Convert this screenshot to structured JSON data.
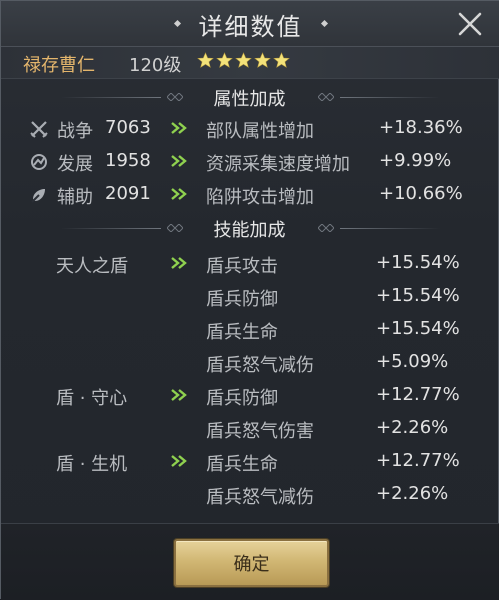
{
  "title": "详细数值",
  "hero": {
    "name": "禄存曹仁",
    "level": "120级",
    "stars": 5
  },
  "sections": {
    "attributes_title": "属性加成",
    "skills_title": "技能加成"
  },
  "attributes": [
    {
      "icon": "crossed-swords-icon",
      "name": "战争",
      "value": "7063",
      "effect": "部队属性增加",
      "bonus": "+18.36%"
    },
    {
      "icon": "development-icon",
      "name": "发展",
      "value": "1958",
      "effect": "资源采集速度增加",
      "bonus": "+9.99%"
    },
    {
      "icon": "assist-icon",
      "name": "辅助",
      "value": "2091",
      "effect": "陷阱攻击增加",
      "bonus": "+10.66%"
    }
  ],
  "skills": [
    {
      "name": "天人之盾",
      "effect": "盾兵攻击",
      "bonus": "+15.54%"
    },
    {
      "name": "",
      "effect": "盾兵防御",
      "bonus": "+15.54%"
    },
    {
      "name": "",
      "effect": "盾兵生命",
      "bonus": "+15.54%"
    },
    {
      "name": "",
      "effect": "盾兵怒气减伤",
      "bonus": "+5.09%"
    },
    {
      "name": "盾 · 守心",
      "effect": "盾兵防御",
      "bonus": "+12.77%"
    },
    {
      "name": "",
      "effect": "盾兵怒气伤害",
      "bonus": "+2.26%"
    },
    {
      "name": "盾 · 生机",
      "effect": "盾兵生命",
      "bonus": "+12.77%"
    },
    {
      "name": "",
      "effect": "盾兵怒气减伤",
      "bonus": "+2.26%"
    }
  ],
  "confirm_label": "确定",
  "colors": {
    "gold": "#e3b56c",
    "arrow": "#8fd14f",
    "star": "#f3e27a"
  }
}
